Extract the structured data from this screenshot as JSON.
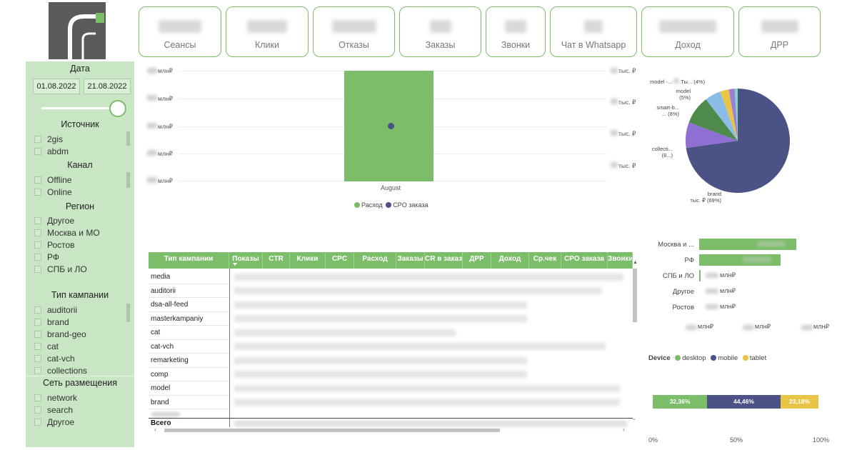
{
  "kpis": [
    {
      "label": "Сеансы"
    },
    {
      "label": "Клики"
    },
    {
      "label": "Отказы"
    },
    {
      "label": "Заказы"
    },
    {
      "label": "Звонки"
    },
    {
      "label": "Чат в Whatsapp"
    },
    {
      "label": "Доход"
    },
    {
      "label": "ДРР"
    }
  ],
  "filters": {
    "date": {
      "title": "Дата",
      "from": "01.08.2022",
      "to": "21.08.2022"
    },
    "source": {
      "title": "Источник",
      "items": [
        "2gis",
        "abdm"
      ]
    },
    "channel": {
      "title": "Канал",
      "items": [
        "Offline",
        "Online"
      ]
    },
    "region": {
      "title": "Регион",
      "items": [
        "Другое",
        "Москва и МО",
        "Ростов",
        "РФ",
        "СПБ и ЛО"
      ]
    },
    "campaign_type": {
      "title": "Тип кампании",
      "items": [
        "auditorii",
        "brand",
        "brand-geo",
        "cat",
        "cat-vch",
        "collections"
      ]
    },
    "network": {
      "title": "Сеть размещения",
      "items": [
        "network",
        "search",
        "Другое"
      ]
    }
  },
  "combo_chart": {
    "left_unit": "млн₽",
    "right_unit": "тыс. ₽",
    "category": "August",
    "legend": [
      {
        "name": "Расход",
        "color": "#7cbd6a"
      },
      {
        "name": "CPO заказа",
        "color": "#4a5286"
      }
    ]
  },
  "pie": {
    "labels": [
      {
        "l1": "model -...",
        "l2": "Ты... (4%)"
      },
      {
        "l1": "model",
        "l2": "(5%)"
      },
      {
        "l1": "smart-b...",
        "l2": "... (8%)"
      },
      {
        "l1": "collecti...",
        "l2": "(8...)"
      },
      {
        "l1": "brand",
        "l2": "тыс. ₽ (69%)"
      }
    ]
  },
  "table": {
    "columns": [
      "Тип кампании",
      "Показы",
      "CTR",
      "Клики",
      "CPC",
      "Расход",
      "Заказы",
      "CR в заказ",
      "ДРР",
      "Доход",
      "Ср.чек",
      "CPO заказа",
      "Звонки"
    ],
    "rows": [
      "media",
      "auditorii",
      "dsa-all-feed",
      "masterkampaniy",
      "cat",
      "cat-vch",
      "remarketing",
      "comp",
      "model",
      "brand"
    ],
    "total_label": "Всего"
  },
  "region_chart": {
    "unit": "млн₽",
    "categories": [
      "Москва и ...",
      "РФ",
      "СПБ и ЛО",
      "Другое",
      "Ростов"
    ]
  },
  "device": {
    "title": "Device",
    "legend": [
      {
        "name": "desktop",
        "color": "#7cbd6a"
      },
      {
        "name": "mobile",
        "color": "#4a5286"
      },
      {
        "name": "tablet",
        "color": "#e8c547"
      }
    ],
    "segments": [
      {
        "label": "32,36%",
        "value": 32.36
      },
      {
        "label": "44,46%",
        "value": 44.46
      },
      {
        "label": "23,18%",
        "value": 23.18
      }
    ],
    "ticks": [
      "0%",
      "50%",
      "100%"
    ]
  },
  "colors": {
    "accent": "#7cbd6a",
    "navy": "#4a5286",
    "panel": "#c8e6c4"
  }
}
